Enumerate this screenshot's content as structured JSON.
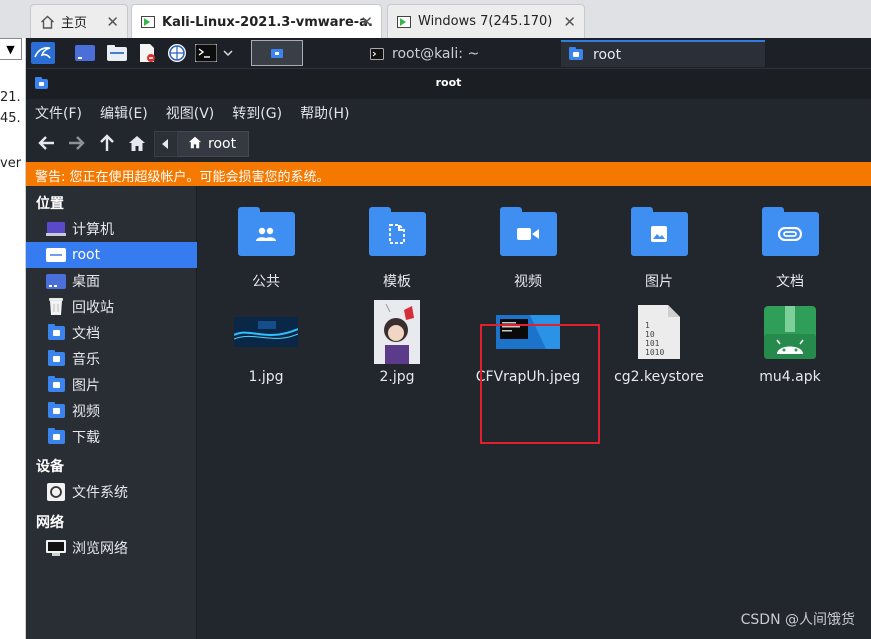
{
  "host": {
    "tabs": [
      {
        "label": "主页",
        "icon": "home-icon",
        "close": "✕"
      },
      {
        "label": "Kali-Linux-2021.3-vmware-a...",
        "icon": "vm-icon",
        "close": "✕"
      },
      {
        "label": "Windows 7(245.170)",
        "icon": "vm-icon",
        "close": "✕"
      }
    ],
    "side_fragments": [
      "21.",
      "45.",
      "ver"
    ]
  },
  "panel": {
    "windows": [
      {
        "label": "root@kali: ~",
        "icon": "terminal-icon"
      },
      {
        "label": "root",
        "icon": "folder-icon"
      }
    ]
  },
  "window": {
    "title": "root"
  },
  "menu": [
    "文件(F)",
    "编辑(E)",
    "视图(V)",
    "转到(G)",
    "帮助(H)"
  ],
  "breadcrumb": {
    "current": "root"
  },
  "warning": "警告: 您正在使用超级帐户。可能会损害您的系统。",
  "sidebar": {
    "sections": [
      {
        "heading": "位置",
        "items": [
          {
            "label": "计算机",
            "icon": "computer-icon"
          },
          {
            "label": "root",
            "icon": "home-folder-icon",
            "selected": true
          },
          {
            "label": "桌面",
            "icon": "desktop-icon"
          },
          {
            "label": "回收站",
            "icon": "trash-icon"
          },
          {
            "label": "文档",
            "icon": "documents-folder-icon"
          },
          {
            "label": "音乐",
            "icon": "music-folder-icon"
          },
          {
            "label": "图片",
            "icon": "pictures-folder-icon"
          },
          {
            "label": "视频",
            "icon": "videos-folder-icon"
          },
          {
            "label": "下载",
            "icon": "downloads-folder-icon"
          }
        ]
      },
      {
        "heading": "设备",
        "items": [
          {
            "label": "文件系统",
            "icon": "drive-icon"
          }
        ]
      },
      {
        "heading": "网络",
        "items": [
          {
            "label": "浏览网络",
            "icon": "network-icon"
          }
        ]
      }
    ]
  },
  "files": [
    {
      "name": "公共",
      "icon": "public-folder-icon"
    },
    {
      "name": "模板",
      "icon": "templates-folder-icon"
    },
    {
      "name": "视频",
      "icon": "videos-folder-icon"
    },
    {
      "name": "图片",
      "icon": "pictures-folder-icon"
    },
    {
      "name": "文档",
      "icon": "documents-folder-icon"
    },
    {
      "name": "1.jpg",
      "icon": "image-thumbnail"
    },
    {
      "name": "2.jpg",
      "icon": "image-thumbnail"
    },
    {
      "name": "CFVrapUh.jpeg",
      "icon": "image-thumbnail",
      "highlighted": true
    },
    {
      "name": "cg2.keystore",
      "icon": "binary-file-icon"
    },
    {
      "name": "mu4.apk",
      "icon": "android-package-icon"
    }
  ],
  "watermark": "CSDN @人间饿货",
  "colors": {
    "accent": "#367bf0",
    "warning": "#f57900",
    "folder": "#3f8ef2",
    "highlight_box": "#e0212d"
  }
}
